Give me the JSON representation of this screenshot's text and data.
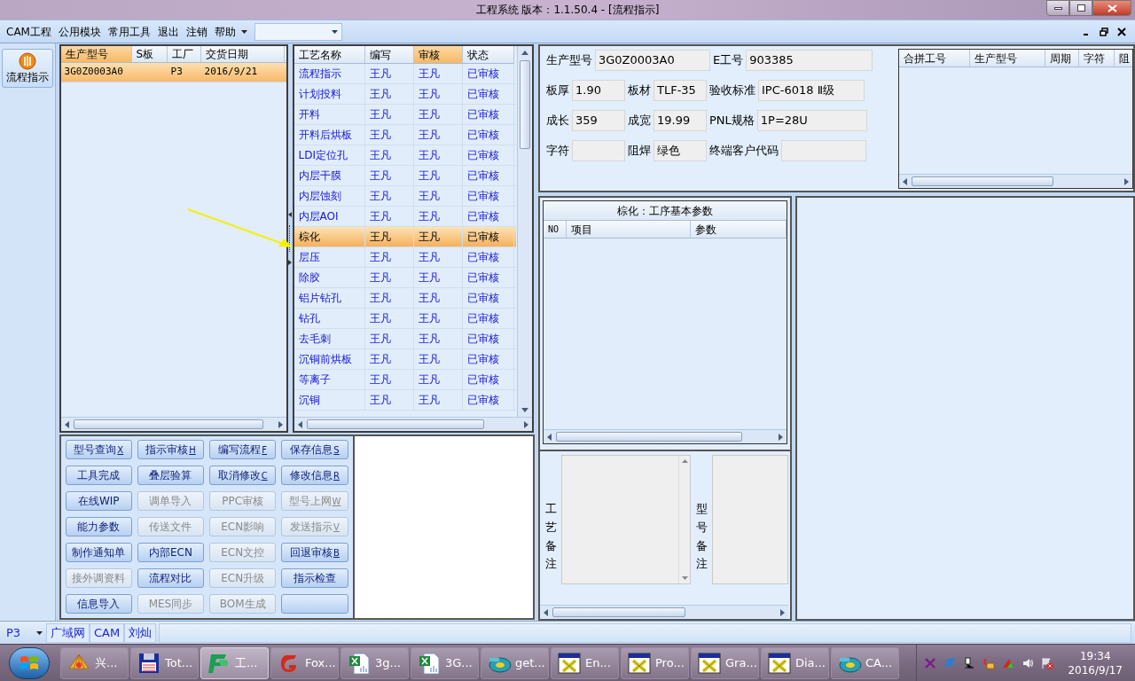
{
  "window": {
    "title": "工程系统   版本：1.1.50.4 - [流程指示]"
  },
  "menu": {
    "items": [
      "CAM工程",
      "公用模块",
      "常用工具",
      "退出",
      "注销",
      "帮助"
    ]
  },
  "sidebar": {
    "button": "流程指示"
  },
  "orders": {
    "columns": [
      {
        "label": "生产型号",
        "highlighted": true
      },
      {
        "label": "S板",
        "highlighted": false
      },
      {
        "label": "工厂",
        "highlighted": false
      },
      {
        "label": "交货日期",
        "highlighted": false
      }
    ],
    "rows": [
      {
        "cells": [
          "3G0Z0003A0",
          "",
          "P3",
          "2016/9/21"
        ],
        "selected": true
      }
    ]
  },
  "process": {
    "columns": [
      {
        "label": "工艺名称",
        "highlighted": false
      },
      {
        "label": "编写",
        "highlighted": false
      },
      {
        "label": "审核",
        "highlighted": true
      },
      {
        "label": "状态",
        "highlighted": false
      }
    ],
    "rows": [
      {
        "cells": [
          "流程指示",
          "王凡",
          "王凡",
          "已审核"
        ],
        "selected": false
      },
      {
        "cells": [
          "计划投料",
          "王凡",
          "王凡",
          "已审核"
        ],
        "selected": false
      },
      {
        "cells": [
          "开料",
          "王凡",
          "王凡",
          "已审核"
        ],
        "selected": false
      },
      {
        "cells": [
          "开料后烘板",
          "王凡",
          "王凡",
          "已审核"
        ],
        "selected": false
      },
      {
        "cells": [
          "LDI定位孔",
          "王凡",
          "王凡",
          "已审核"
        ],
        "selected": false
      },
      {
        "cells": [
          "内层干膜",
          "王凡",
          "王凡",
          "已审核"
        ],
        "selected": false
      },
      {
        "cells": [
          "内层蚀刻",
          "王凡",
          "王凡",
          "已审核"
        ],
        "selected": false
      },
      {
        "cells": [
          "内层AOI",
          "王凡",
          "王凡",
          "已审核"
        ],
        "selected": false
      },
      {
        "cells": [
          "棕化",
          "王凡",
          "王凡",
          "已审核"
        ],
        "selected": true
      },
      {
        "cells": [
          "层压",
          "王凡",
          "王凡",
          "已审核"
        ],
        "selected": false
      },
      {
        "cells": [
          "除胶",
          "王凡",
          "王凡",
          "已审核"
        ],
        "selected": false
      },
      {
        "cells": [
          "铝片钻孔",
          "王凡",
          "王凡",
          "已审核"
        ],
        "selected": false
      },
      {
        "cells": [
          "钻孔",
          "王凡",
          "王凡",
          "已审核"
        ],
        "selected": false
      },
      {
        "cells": [
          "去毛刺",
          "王凡",
          "王凡",
          "已审核"
        ],
        "selected": false
      },
      {
        "cells": [
          "沉铜前烘板",
          "王凡",
          "王凡",
          "已审核"
        ],
        "selected": false
      },
      {
        "cells": [
          "等离子",
          "王凡",
          "王凡",
          "已审核"
        ],
        "selected": false
      },
      {
        "cells": [
          "沉铜",
          "王凡",
          "王凡",
          "已审核"
        ],
        "selected": false
      }
    ]
  },
  "info": {
    "fields": [
      {
        "kind": "wide",
        "label": "生产型号",
        "value": "3G0Z0003A0"
      },
      {
        "kind": "normal",
        "label": "E工号",
        "value": "903385"
      },
      {
        "kind": "normal",
        "label": "板厚",
        "value": "1.90"
      },
      {
        "kind": "normal",
        "label": "板材",
        "value": "TLF-35"
      },
      {
        "kind": "normal",
        "label": "验收标准",
        "value": "IPC-6018 Ⅱ级"
      },
      {
        "kind": "normal",
        "label": "成长",
        "value": "359"
      },
      {
        "kind": "normal",
        "label": "成宽",
        "value": "19.99"
      },
      {
        "kind": "normal",
        "label": "PNL规格",
        "value": "1P=28U"
      },
      {
        "kind": "normal",
        "label": "字符"
      },
      {
        "kind": "normal",
        "label": "阻焊",
        "value": "绿色"
      },
      {
        "kind": "normal",
        "label": "终端客户代码"
      }
    ]
  },
  "merge_table": {
    "columns": [
      "合拼工号",
      "生产型号",
      "周期",
      "字符",
      "阻"
    ]
  },
  "params": {
    "title": "棕化：工序基本参数",
    "columns": [
      "NO",
      "项目",
      "参数"
    ]
  },
  "notes": [
    {
      "label": "工艺备注"
    },
    {
      "label": "型号备注"
    }
  ],
  "buttons": [
    {
      "label": "型号查询",
      "hotkey": "X",
      "disabled": false
    },
    {
      "label": "指示审核",
      "hotkey": "H",
      "disabled": false
    },
    {
      "label": "编写流程",
      "hotkey": "F",
      "disabled": false
    },
    {
      "label": "保存信息",
      "hotkey": "S",
      "disabled": false
    },
    {
      "label": "工具完成",
      "disabled": false
    },
    {
      "label": "叠层验算",
      "disabled": false
    },
    {
      "label": "取消修改",
      "hotkey": "C",
      "disabled": false
    },
    {
      "label": "修改信息",
      "hotkey": "R",
      "disabled": false
    },
    {
      "label": "在线WIP",
      "disabled": false
    },
    {
      "label": "调单导入",
      "disabled": true
    },
    {
      "label": "PPC审核",
      "disabled": true
    },
    {
      "label": "型号上网",
      "hotkey": "W",
      "disabled": true
    },
    {
      "label": "能力参数",
      "disabled": false
    },
    {
      "label": "传送文件",
      "disabled": true
    },
    {
      "label": "ECN影响",
      "disabled": true
    },
    {
      "label": "发送指示",
      "hotkey": "V",
      "disabled": true
    },
    {
      "label": "制作通知单",
      "disabled": false
    },
    {
      "label": "内部ECN",
      "disabled": false
    },
    {
      "label": "ECN文控",
      "disabled": true
    },
    {
      "label": "回退审核",
      "hotkey": "B",
      "disabled": false
    },
    {
      "label": "接外调资料",
      "disabled": true
    },
    {
      "label": "流程对比",
      "disabled": false
    },
    {
      "label": "ECN升级",
      "disabled": true
    },
    {
      "label": "指示检查",
      "disabled": false
    },
    {
      "label": "信息导入",
      "disabled": false
    },
    {
      "label": "MES同步",
      "disabled": true
    },
    {
      "label": "BOM生成",
      "disabled": true
    },
    {
      "disabled": false
    }
  ],
  "status_bar": {
    "dropdown": "P3",
    "items": [
      "广域网",
      "CAM",
      "刘灿"
    ]
  },
  "taskbar": {
    "items": [
      {
        "kind": "shell",
        "label": "兴...",
        "selected": false
      },
      {
        "kind": "floppy",
        "label": "Tot...",
        "selected": false
      },
      {
        "kind": "fp",
        "label": "工...",
        "selected": true
      },
      {
        "kind": "foxit",
        "label": "Fox...",
        "selected": false
      },
      {
        "kind": "excel",
        "label": "3g...",
        "selected": false
      },
      {
        "kind": "excel",
        "label": "3G...",
        "selected": false
      },
      {
        "kind": "disc",
        "label": "get...",
        "selected": false
      },
      {
        "kind": "window",
        "label": "En...",
        "selected": false
      },
      {
        "kind": "window",
        "label": "Pro...",
        "selected": false
      },
      {
        "kind": "window",
        "label": "Gra...",
        "selected": false
      },
      {
        "kind": "window",
        "label": "Dia...",
        "selected": false
      },
      {
        "kind": "disc",
        "label": "CA...",
        "selected": false
      }
    ],
    "clock": {
      "time": "19:34",
      "date": "2016/9/17"
    }
  }
}
